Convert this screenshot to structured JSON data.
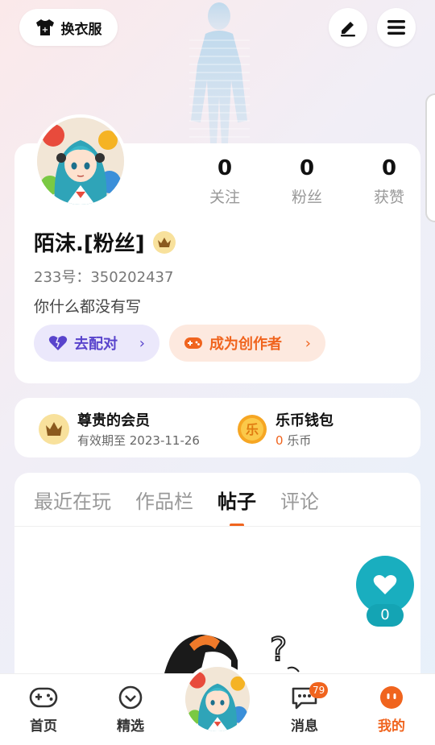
{
  "top_bar": {
    "dress_label": "换衣服",
    "edit_icon": "pen-icon",
    "menu_icon": "menu-icon"
  },
  "profile": {
    "stats": [
      {
        "value": "0",
        "label": "关注"
      },
      {
        "value": "0",
        "label": "粉丝"
      },
      {
        "value": "0",
        "label": "获赞"
      }
    ],
    "username": "陌沫.[粉丝]",
    "id_text": "233号：350202437",
    "bio": "你什么都没有写",
    "pair_button": "去配对",
    "creator_button": "成为创作者",
    "chevron": "›"
  },
  "member": {
    "vip_title": "尊贵的会员",
    "vip_sub": "有效期至 2023-11-26",
    "wallet_title": "乐币钱包",
    "wallet_amount": "0",
    "wallet_unit": "乐币",
    "coin_char": "乐"
  },
  "tabs": [
    {
      "label": "最近在玩"
    },
    {
      "label": "作品栏"
    },
    {
      "label": "帖子"
    },
    {
      "label": "评论"
    }
  ],
  "like": {
    "count": "0"
  },
  "nav": [
    {
      "label": "首页",
      "icon": "gamepad-icon"
    },
    {
      "label": "精选",
      "icon": "heart-circle-icon"
    },
    {
      "label": "消息",
      "icon": "message-icon",
      "badge": "79"
    },
    {
      "label": "我的",
      "icon": "face-icon"
    }
  ],
  "colors": {
    "accent": "#f0641e",
    "purple": "#5944cc",
    "teal": "#19aebf"
  }
}
